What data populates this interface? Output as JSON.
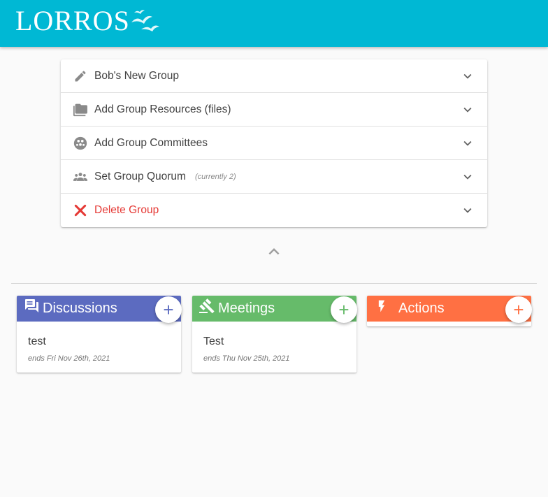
{
  "header": {
    "logo_text": "LORROS",
    "brand_color": "#00b8d4"
  },
  "group_panel": {
    "rows": [
      {
        "label": "Bob's New Group",
        "icon": "pencil-icon"
      },
      {
        "label": "Add Group Resources (files)",
        "icon": "folders-icon"
      },
      {
        "label": "Add Group Committees",
        "icon": "committee-icon"
      },
      {
        "label": "Set Group Quorum",
        "note": "(currently 2)",
        "icon": "people-icon"
      },
      {
        "label": "Delete Group",
        "icon": "close-icon",
        "color": "#e53935"
      }
    ]
  },
  "cards": {
    "discussions": {
      "title": "Discussions",
      "color": "#5c6bc0",
      "icon": "forum-icon",
      "item_title": "test",
      "item_sub": "ends Fri Nov 26th, 2021"
    },
    "meetings": {
      "title": "Meetings",
      "color": "#66bb6a",
      "icon": "gavel-icon",
      "item_title": "Test",
      "item_sub": "ends Thu Nov 25th, 2021"
    },
    "actions": {
      "title": "Actions",
      "color": "#ff7043",
      "icon": "flash-icon"
    }
  }
}
